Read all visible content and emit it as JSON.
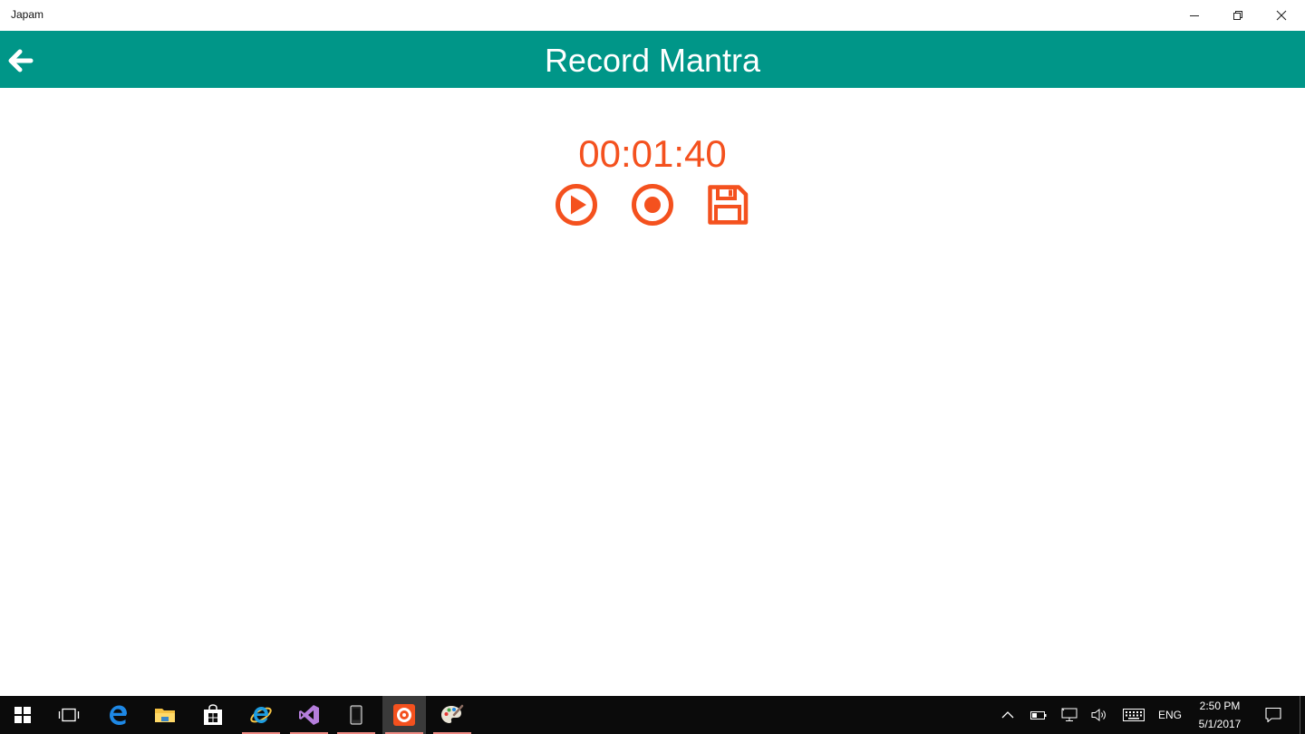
{
  "window": {
    "title": "Japam"
  },
  "header": {
    "title": "Record Mantra"
  },
  "recorder": {
    "elapsed": "00:01:40"
  },
  "colors": {
    "header_bg": "#009688",
    "accent": "#F4511E",
    "taskbar_bg": "#0B0B0B"
  },
  "taskbar": {
    "apps": [
      {
        "icon": "windows-start-icon"
      },
      {
        "icon": "task-view-icon"
      },
      {
        "icon": "edge-icon"
      },
      {
        "icon": "file-explorer-icon"
      },
      {
        "icon": "store-icon"
      },
      {
        "icon": "internet-explorer-icon"
      },
      {
        "icon": "visual-studio-icon"
      },
      {
        "icon": "phone-emulator-icon"
      },
      {
        "icon": "japam-app-icon"
      },
      {
        "icon": "paint-icon"
      }
    ],
    "tray": {
      "language": "ENG",
      "time": "2:50 PM",
      "date": "5/1/2017"
    }
  }
}
